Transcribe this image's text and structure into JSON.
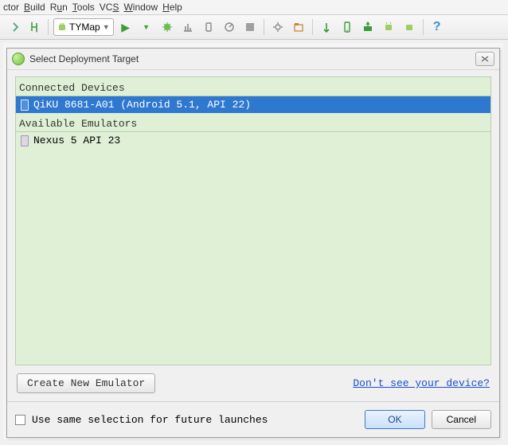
{
  "menubar": {
    "items": [
      "ctor",
      "Build",
      "Run",
      "Tools",
      "VCS",
      "Window",
      "Help"
    ]
  },
  "toolbar": {
    "run_config_label": "TYMap"
  },
  "dialog": {
    "title": "Select Deployment Target",
    "sections": {
      "connected_label": "Connected Devices",
      "emulators_label": "Available Emulators"
    },
    "connected": [
      {
        "label": "QiKU 8681-A01 (Android 5.1, API 22)",
        "selected": true
      }
    ],
    "emulators": [
      {
        "label": "Nexus 5 API 23"
      }
    ],
    "create_emulator_label": "Create New Emulator",
    "help_link_label": "Don't see your device?",
    "remember_label": "Use same selection for future launches",
    "ok_label": "OK",
    "cancel_label": "Cancel"
  }
}
